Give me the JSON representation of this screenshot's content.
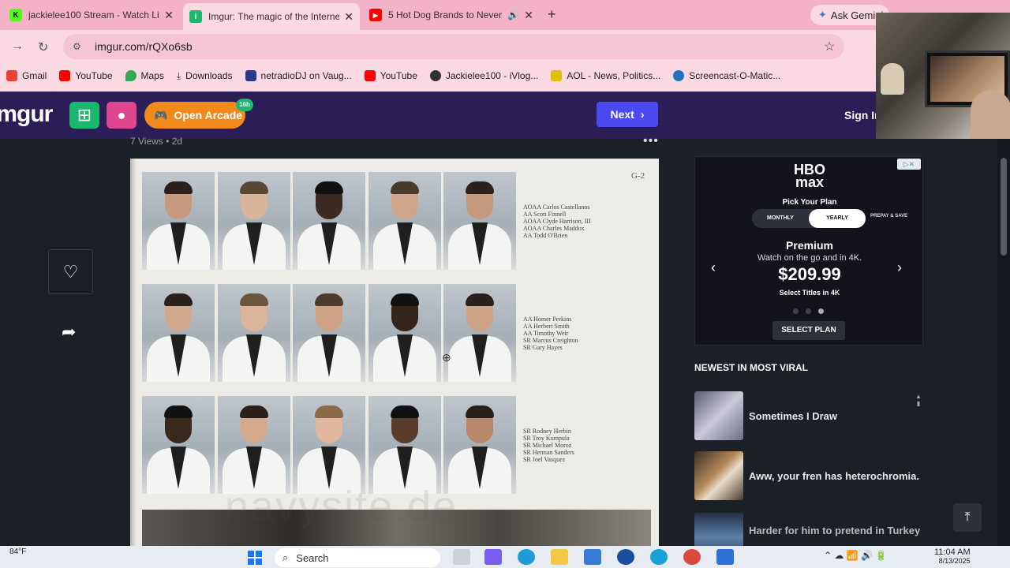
{
  "tabs": [
    {
      "title": "jackielee100 Stream - Watch Liv",
      "favicon_color": "#53fc18",
      "favicon_letter": "K"
    },
    {
      "title": "Imgur: The magic of the Interne",
      "favicon_color": "#1bb76e",
      "favicon_letter": "i"
    },
    {
      "title": "5 Hot Dog Brands to Never",
      "favicon_color": "#ff0000",
      "favicon_letter": "▶"
    }
  ],
  "browser": {
    "url": "imgur.com/rQXo6sb",
    "gemini_label": "Ask Gemini",
    "bookmarks": [
      {
        "label": "Gmail",
        "color": "#ea4335"
      },
      {
        "label": "YouTube",
        "color": "#ff0000"
      },
      {
        "label": "Maps",
        "color": "#34a853"
      },
      {
        "label": "Downloads",
        "color": "#555555"
      },
      {
        "label": "netradioDJ on Vaug...",
        "color": "#2b3a8c"
      },
      {
        "label": "YouTube",
        "color": "#ff0000"
      },
      {
        "label": "Jackielee100 - iVlog...",
        "color": "#333333"
      },
      {
        "label": "AOL - News, Politics...",
        "color": "#e0c000"
      },
      {
        "label": "Screencast-O-Matic...",
        "color": "#1e73be"
      }
    ]
  },
  "imgur": {
    "logo": "imgur",
    "arcade_label": "Open Arcade",
    "arcade_badge": "16h",
    "next_label": "Next",
    "sign_in": "Sign In",
    "views": "7 Views",
    "age": "2d"
  },
  "yearbook": {
    "page_label": "G-2",
    "rows": [
      {
        "names": [
          "AOAA Carlos Castellanos",
          "AA Scott Finnell",
          "AOAA Clyde Harrison, III",
          "AOAA Charles Maddox",
          "AA Todd O'Brien"
        ]
      },
      {
        "names": [
          "AA Homer Perkins",
          "AA Herbert Smith",
          "AA Timothy Weir",
          "SR Marcus Creighton",
          "SR Gary Hayes"
        ]
      },
      {
        "names": [
          "SR Rodney Herbin",
          "SR Troy Kumpula",
          "SR Michael Moroz",
          "SR Herman Sanders",
          "SR Joel Vasquez"
        ]
      }
    ],
    "watermark": "navysite.de"
  },
  "ad": {
    "brand_line1": "HBO",
    "brand_line2": "max",
    "pick": "Pick Your Plan",
    "monthly": "MONTHLY",
    "yearly": "YEARLY",
    "prepay": "PREPAY & SAVE",
    "plan": "Premium",
    "desc": "Watch on the go and in 4K.",
    "price": "$209.99",
    "select_titles": "Select Titles in 4K",
    "cta": "SELECT PLAN",
    "active_dot": 3
  },
  "sidebar": {
    "heading": "NEWEST IN MOST VIRAL",
    "items": [
      {
        "title": "Sometimes I Draw",
        "thumb_color": "#8a8aa0"
      },
      {
        "title": "Aww, your fren has heterochromia.",
        "thumb_color": "#6b5a46"
      },
      {
        "title": "Harder for him to pretend in Turkey",
        "thumb_color": "#3f5a7a"
      }
    ]
  },
  "taskbar": {
    "weather": "84°F",
    "search": "Search",
    "time": "11:04 AM",
    "date": "8/13/2025"
  }
}
